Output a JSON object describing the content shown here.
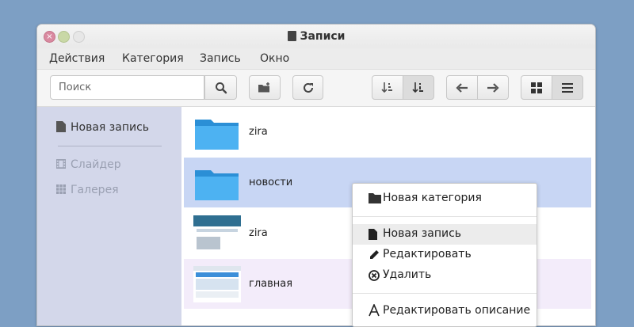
{
  "window": {
    "title": "Записи"
  },
  "menubar": {
    "items": [
      "Действия",
      "Категория",
      "Запись",
      "Окно"
    ]
  },
  "toolbar": {
    "search_placeholder": "Поиск"
  },
  "sidebar": {
    "new_post": "Новая запись",
    "items": [
      {
        "label": "Слайдер",
        "icon": "film-icon"
      },
      {
        "label": "Галерея",
        "icon": "grid-icon"
      }
    ]
  },
  "list": {
    "items": [
      {
        "label": "zira",
        "type": "folder"
      },
      {
        "label": "новости",
        "type": "folder",
        "selected": true
      },
      {
        "label": "zira",
        "type": "image"
      },
      {
        "label": "главная",
        "type": "image"
      }
    ]
  },
  "context_menu": {
    "items": [
      {
        "label": "Новая категория",
        "icon": "folder-icon"
      },
      {
        "label": "Новая запись",
        "icon": "document-icon",
        "highlighted": true
      },
      {
        "label": "Редактировать",
        "icon": "pencil-icon"
      },
      {
        "label": "Удалить",
        "icon": "delete-icon"
      },
      {
        "label": "Редактировать описание",
        "icon": "text-icon"
      }
    ]
  },
  "colors": {
    "background": "#7d9fc4",
    "sidebar": "#d3d7ea",
    "selected_row": "#c8d6f4",
    "folder": "#4db2f2",
    "close": "#d989a0",
    "minimize": "#c9d8a6"
  }
}
